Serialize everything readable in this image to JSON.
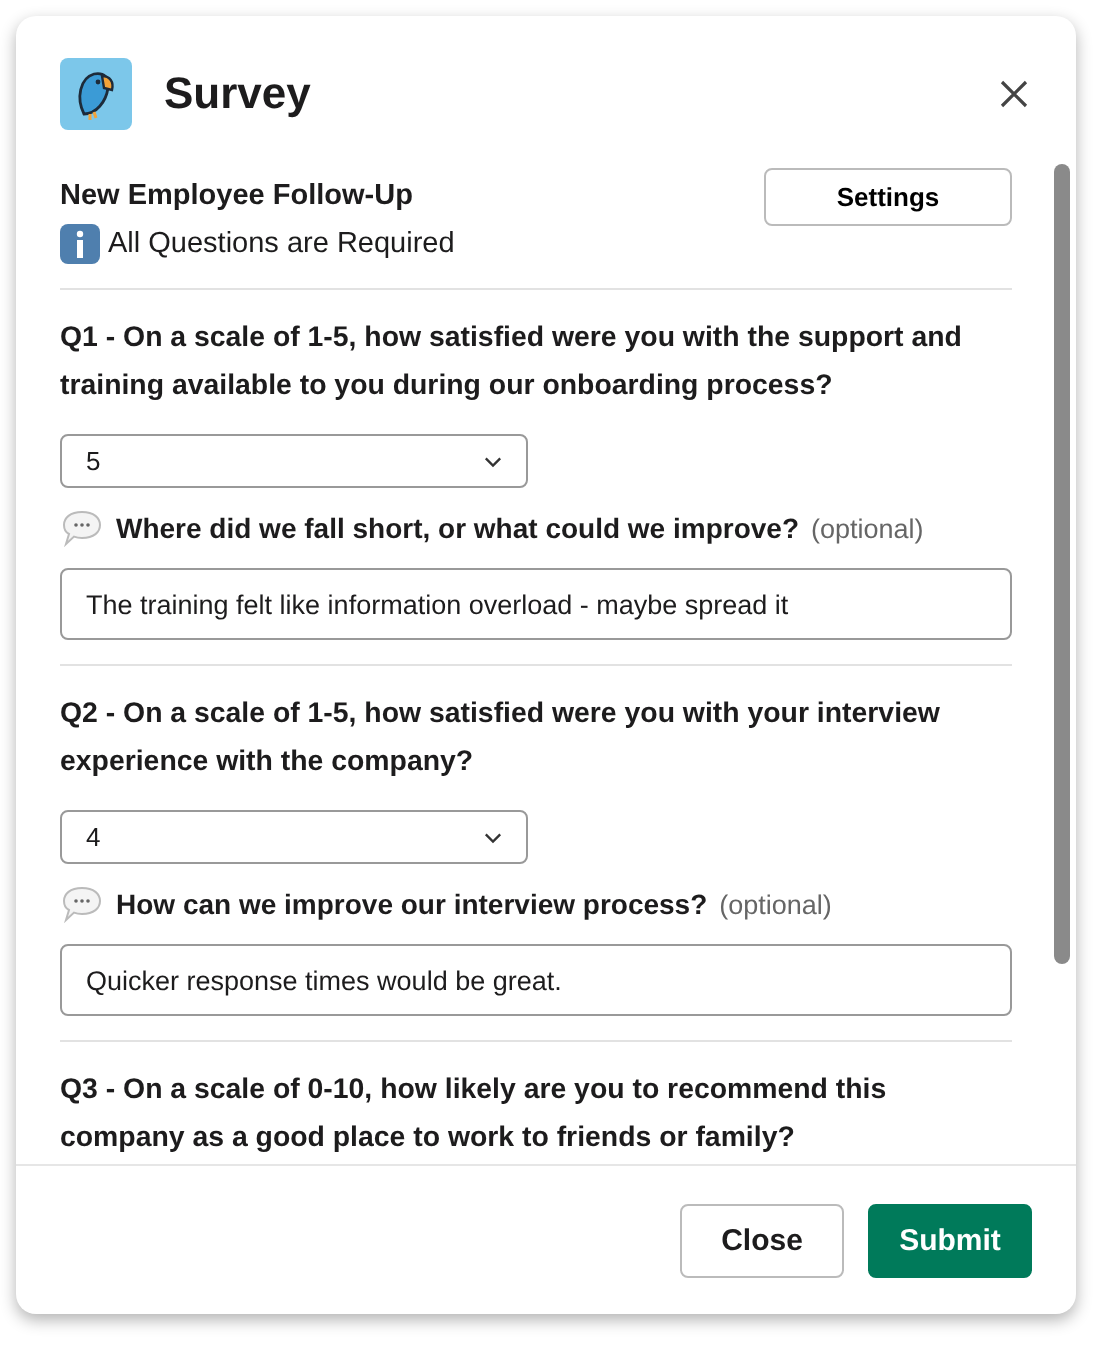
{
  "window": {
    "title": "Survey"
  },
  "survey": {
    "name": "New Employee Follow-Up",
    "settings_button": "Settings",
    "notice": "All Questions are Required"
  },
  "questions": [
    {
      "question": "Q1 - On a scale of 1-5, how satisfied were you with the support and training available to you during our onboarding process?",
      "rating": "5",
      "follow_up": "Where did we fall short, or what could we improve?",
      "optional": "(optional)",
      "answer": "The training felt like information overload - maybe spread it"
    },
    {
      "question": "Q2 - On a scale of 1-5, how satisfied were you with your interview experience with the company?",
      "rating": "4",
      "follow_up": "How can we improve our interview process?",
      "optional": "(optional)",
      "answer": "Quicker response times would be great."
    },
    {
      "question": "Q3 - On a scale of 0-10, how likely are you to recommend this company as a good place to work to friends or family?"
    }
  ],
  "buttons": [
    {
      "label": "Close",
      "kind": "secondary"
    },
    {
      "label": "Submit",
      "kind": "primary"
    }
  ]
}
